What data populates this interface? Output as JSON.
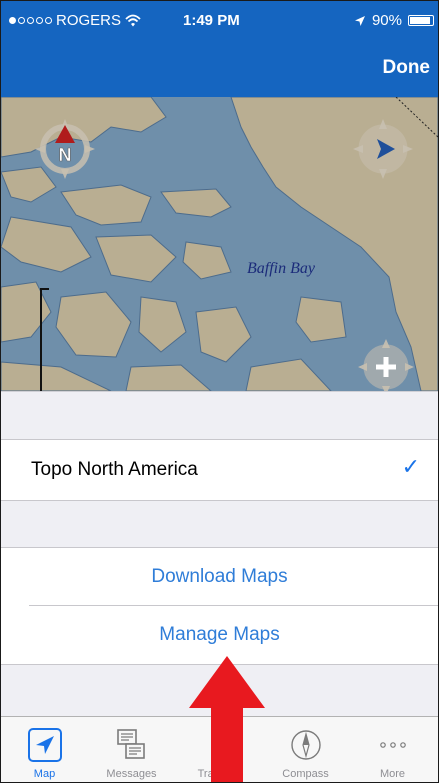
{
  "status_bar": {
    "carrier": "ROGERS",
    "time": "1:49 PM",
    "battery": "90%",
    "battery_level": 0.9,
    "signal_bars": 1
  },
  "nav": {
    "done_label": "Done"
  },
  "map": {
    "label": "Baffin Bay",
    "compass_letter": "N",
    "icons": [
      "north-compass-icon",
      "location-icon",
      "zoom-in-icon"
    ]
  },
  "list": {
    "selected_map": "Topo North America",
    "checkmark": "✓",
    "download_label": "Download Maps",
    "manage_label": "Manage Maps"
  },
  "tabs": [
    {
      "label": "Map",
      "icon": "map-arrow-icon",
      "active": true
    },
    {
      "label": "Messages",
      "icon": "messages-icon",
      "active": false
    },
    {
      "label": "Tracking",
      "icon": "tracking-icon",
      "active": false
    },
    {
      "label": "Compass",
      "icon": "compass-icon",
      "active": false
    },
    {
      "label": "More",
      "icon": "more-icon",
      "active": false
    }
  ],
  "colors": {
    "nav_blue": "#1565c0",
    "link_blue": "#2f7dd8",
    "annotation_red": "#e8191f",
    "water": "#6f8faa",
    "land": "#b9ae92"
  }
}
